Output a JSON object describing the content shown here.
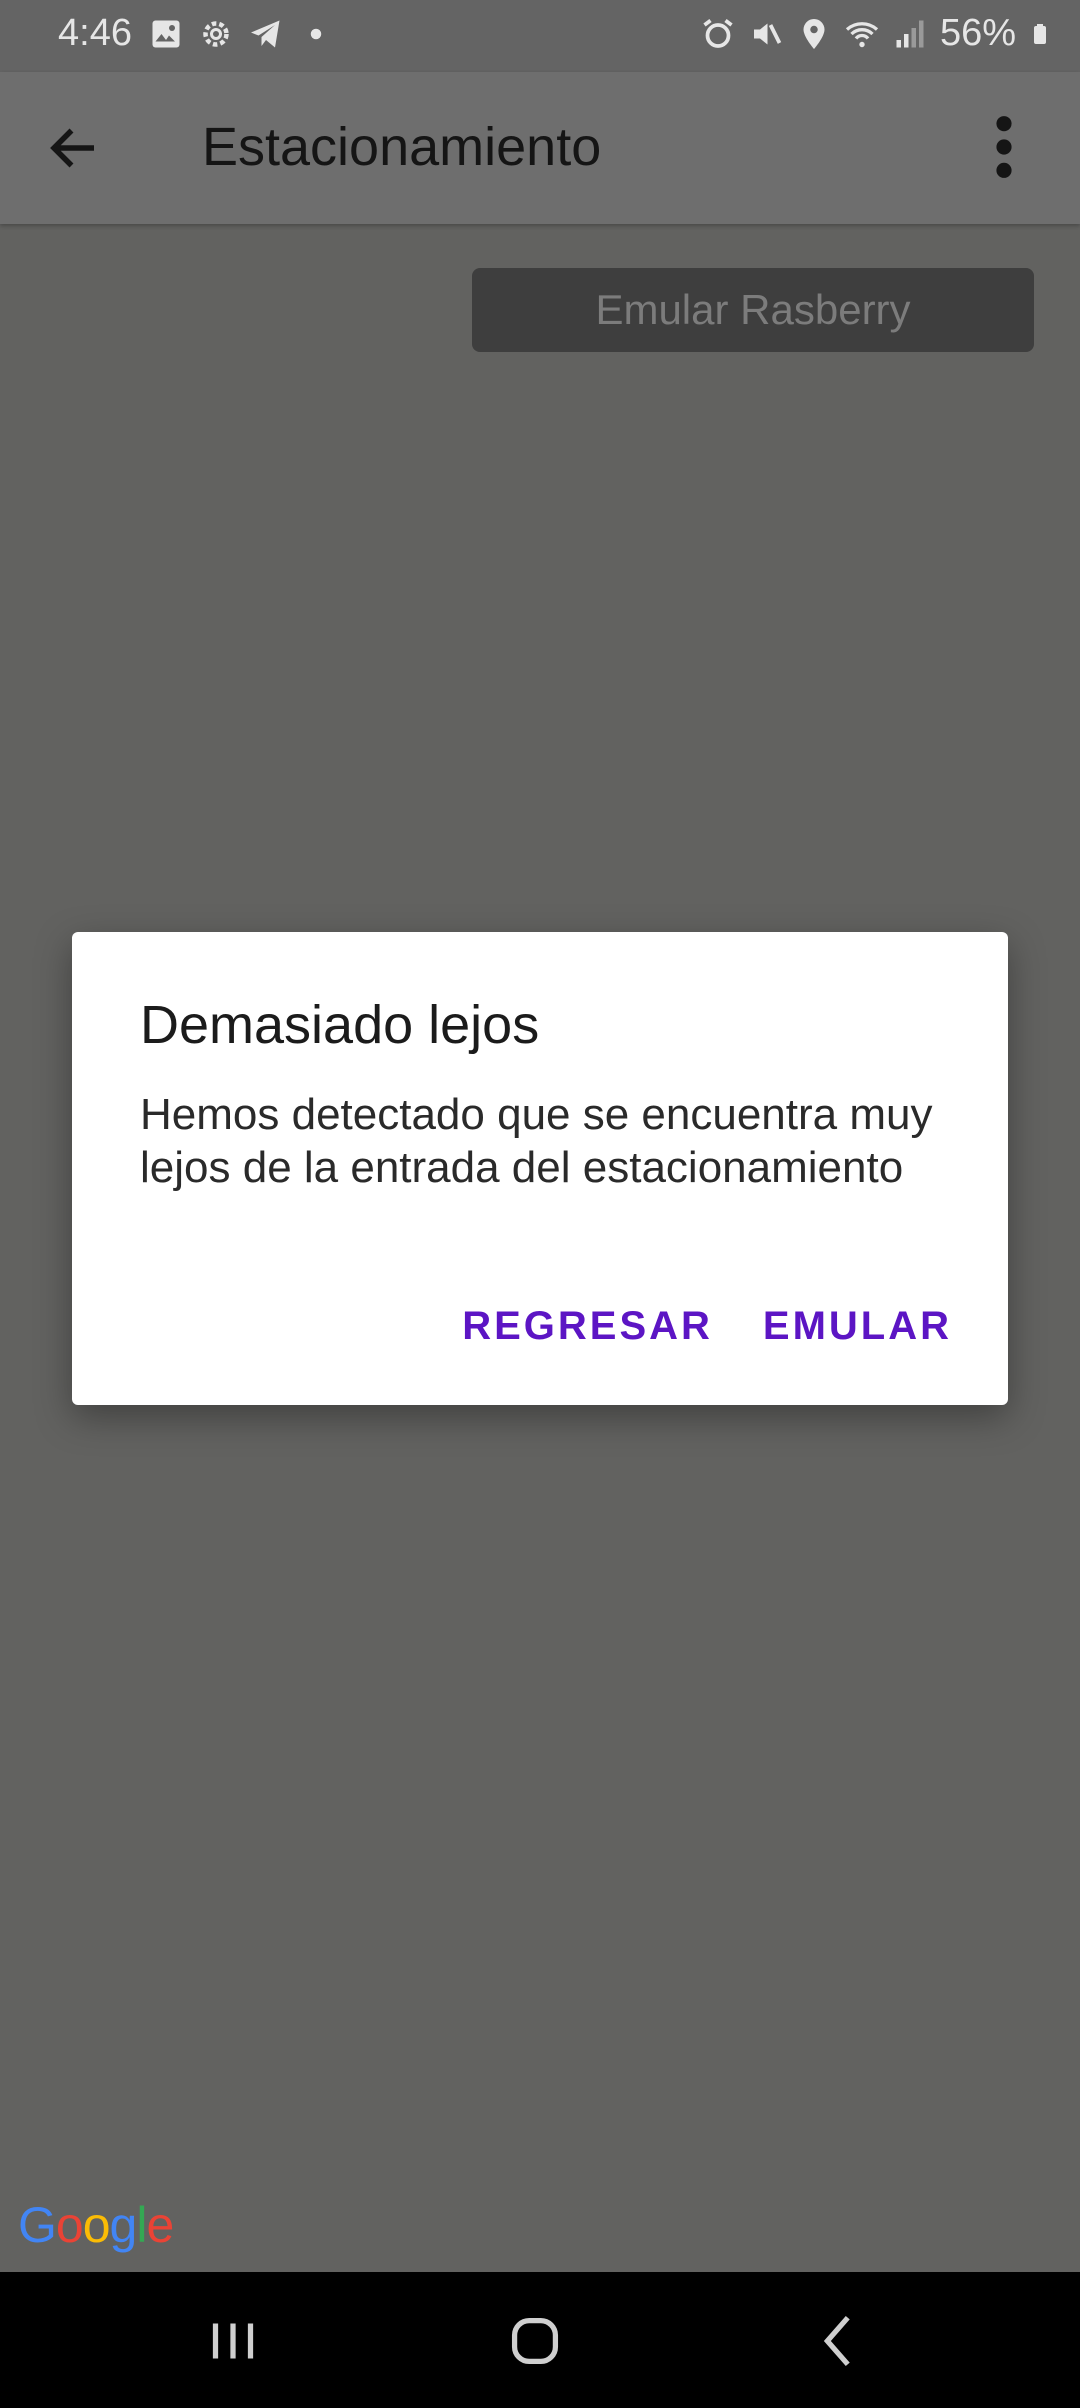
{
  "status_bar": {
    "time": "4:46",
    "battery": "56%"
  },
  "app_bar": {
    "title": "Estacionamiento"
  },
  "main": {
    "emulate_button_label": "Emular Rasberry"
  },
  "dialog": {
    "title": "Demasiado lejos",
    "message": "Hemos detectado que se encuentra muy lejos de la entrada del estacionamiento",
    "negative_label": "REGRESAR",
    "positive_label": "EMULAR"
  },
  "map": {
    "attribution_logo": "Google"
  },
  "colors": {
    "accent": "#5c15c4",
    "scrim": "#626260"
  }
}
